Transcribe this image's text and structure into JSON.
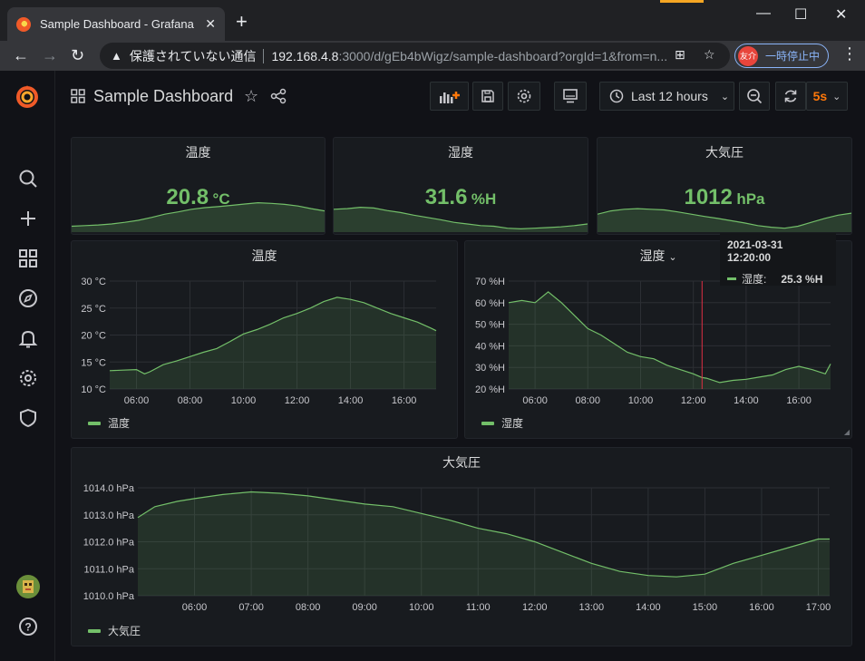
{
  "browser": {
    "tab_title": "Sample Dashboard - Grafana",
    "tab_close": "✕",
    "new_tab": "+",
    "window_controls": [
      "—",
      "☐",
      "✕"
    ],
    "insecure_label": "保護されていない通信",
    "url_host": "192.168.4.8",
    "url_rest": ":3000/d/gEb4bWigz/sample-dashboard?orgId=1&from=n...",
    "profile_initials": "友介",
    "profile_status": "一時停止中"
  },
  "dashboard": {
    "title": "Sample Dashboard",
    "time_range": "Last 12 hours",
    "refresh_interval": "5s"
  },
  "stats": [
    {
      "title": "温度",
      "value": "20.8",
      "unit": "°C",
      "trend": [
        0.18,
        0.2,
        0.22,
        0.25,
        0.3,
        0.36,
        0.45,
        0.55,
        0.62,
        0.7,
        0.75,
        0.78,
        0.82,
        0.86,
        0.9,
        0.88,
        0.85,
        0.8,
        0.72,
        0.65
      ]
    },
    {
      "title": "湿度",
      "value": "31.6",
      "unit": "%H",
      "trend": [
        0.7,
        0.72,
        0.76,
        0.74,
        0.66,
        0.6,
        0.52,
        0.45,
        0.38,
        0.3,
        0.25,
        0.2,
        0.18,
        0.12,
        0.1,
        0.12,
        0.14,
        0.16,
        0.2,
        0.25
      ]
    },
    {
      "title": "大気圧",
      "value": "1012",
      "unit": "hPa",
      "trend": [
        0.55,
        0.65,
        0.7,
        0.72,
        0.7,
        0.68,
        0.62,
        0.55,
        0.48,
        0.42,
        0.35,
        0.28,
        0.2,
        0.15,
        0.12,
        0.18,
        0.3,
        0.42,
        0.52,
        0.58
      ]
    }
  ],
  "charts": {
    "temperature": {
      "title": "温度",
      "legend": "温度"
    },
    "humidity": {
      "title": "湿度",
      "legend": "湿度"
    },
    "pressure": {
      "title": "大気圧",
      "legend": "大気圧"
    }
  },
  "tooltip": {
    "time": "2021-03-31 12:20:00",
    "series": "湿度:",
    "value": "25.3 %H"
  },
  "colors": {
    "series": "#73bf69",
    "panel_bg": "#181b1f",
    "page_bg": "#111217",
    "annotation": "#e02f44",
    "refresh": "#ff780a"
  },
  "chart_data": [
    {
      "type": "area",
      "title": "温度",
      "ylabel": "°C",
      "ylim": [
        10,
        30
      ],
      "yticks": [
        "10 °C",
        "15 °C",
        "20 °C",
        "25 °C",
        "30 °C"
      ],
      "xlim": [
        5.0,
        17.2
      ],
      "xticks": [
        "06:00",
        "08:00",
        "10:00",
        "12:00",
        "14:00",
        "16:00"
      ],
      "series": [
        {
          "name": "温度",
          "x": [
            5.0,
            5.5,
            6.0,
            6.3,
            6.5,
            7.0,
            7.5,
            8.0,
            8.5,
            9.0,
            9.5,
            10.0,
            10.5,
            11.0,
            11.5,
            12.0,
            12.5,
            13.0,
            13.5,
            14.0,
            14.5,
            15.0,
            15.5,
            16.0,
            16.5,
            17.0,
            17.2
          ],
          "y": [
            13.4,
            13.5,
            13.6,
            12.8,
            13.2,
            14.5,
            15.2,
            16.0,
            16.8,
            17.5,
            18.8,
            20.2,
            21.0,
            22.0,
            23.2,
            24.0,
            25.0,
            26.2,
            27.0,
            26.6,
            26.0,
            25.0,
            24.0,
            23.2,
            22.4,
            21.3,
            20.8
          ]
        }
      ]
    },
    {
      "type": "area",
      "title": "湿度",
      "ylabel": "%H",
      "ylim": [
        20,
        70
      ],
      "yticks": [
        "20 %H",
        "30 %H",
        "40 %H",
        "50 %H",
        "60 %H",
        "70 %H"
      ],
      "xlim": [
        5.0,
        17.2
      ],
      "xticks": [
        "06:00",
        "08:00",
        "10:00",
        "12:00",
        "14:00",
        "16:00"
      ],
      "series": [
        {
          "name": "湿度",
          "x": [
            5.0,
            5.5,
            6.0,
            6.5,
            7.0,
            7.5,
            8.0,
            8.5,
            9.0,
            9.5,
            10.0,
            10.5,
            11.0,
            11.5,
            12.0,
            12.33,
            12.5,
            13.0,
            13.5,
            14.0,
            14.5,
            15.0,
            15.5,
            16.0,
            16.5,
            17.0,
            17.2
          ],
          "y": [
            60,
            61,
            60,
            65,
            60,
            54,
            48,
            45,
            41,
            37,
            35,
            34,
            31,
            29,
            27,
            25.3,
            25,
            23,
            24,
            24.5,
            25.5,
            26.5,
            29,
            30.5,
            29,
            27,
            31.6
          ]
        }
      ]
    },
    {
      "type": "area",
      "title": "大気圧",
      "ylabel": "hPa",
      "ylim": [
        1010,
        1014
      ],
      "yticks": [
        "1010.0 hPa",
        "1011.0 hPa",
        "1012.0 hPa",
        "1013.0 hPa",
        "1014.0 hPa"
      ],
      "xlim": [
        5.0,
        17.2
      ],
      "xticks": [
        "06:00",
        "07:00",
        "08:00",
        "09:00",
        "10:00",
        "11:00",
        "12:00",
        "13:00",
        "14:00",
        "15:00",
        "16:00",
        "17:00"
      ],
      "series": [
        {
          "name": "大気圧",
          "x": [
            5.0,
            5.3,
            5.7,
            6.0,
            6.5,
            7.0,
            7.5,
            8.0,
            8.5,
            9.0,
            9.5,
            10.0,
            10.5,
            11.0,
            11.5,
            12.0,
            12.5,
            13.0,
            13.5,
            14.0,
            14.5,
            15.0,
            15.5,
            16.0,
            16.5,
            17.0,
            17.2
          ],
          "y": [
            1012.9,
            1013.3,
            1013.5,
            1013.6,
            1013.75,
            1013.85,
            1013.8,
            1013.7,
            1013.55,
            1013.4,
            1013.3,
            1013.05,
            1012.8,
            1012.5,
            1012.3,
            1012.0,
            1011.6,
            1011.2,
            1010.9,
            1010.75,
            1010.7,
            1010.8,
            1011.2,
            1011.5,
            1011.8,
            1012.1,
            1012.1
          ]
        }
      ]
    }
  ]
}
